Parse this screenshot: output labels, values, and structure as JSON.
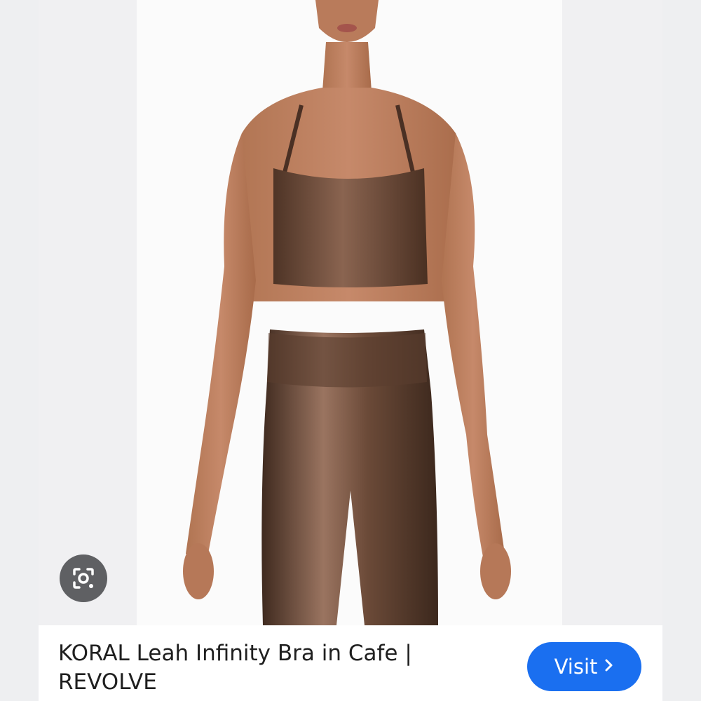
{
  "result": {
    "title": "KORAL Leah Infinity Bra in Cafe | REVOLVE",
    "visit_label": "Visit",
    "visit_icon": "chevron-right-icon",
    "lens_icon": "google-lens-icon",
    "product_image": "product-photo",
    "accent_color": "#1a6ff0"
  }
}
